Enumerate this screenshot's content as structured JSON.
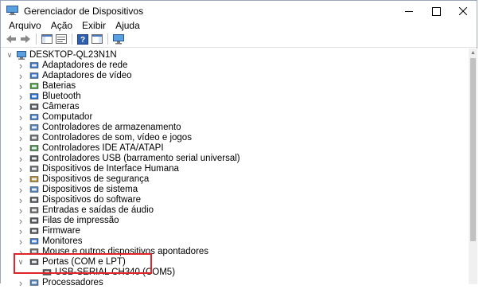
{
  "window": {
    "title": "Gerenciador de Dispositivos"
  },
  "menu": [
    "Arquivo",
    "Ação",
    "Exibir",
    "Ajuda"
  ],
  "tree": {
    "root": "DESKTOP-QL23N1N",
    "categories": [
      {
        "label": "Adaptadores de rede",
        "icon": "network-icon",
        "color": "#3b78c4"
      },
      {
        "label": "Adaptadores de vídeo",
        "icon": "display-adapter-icon",
        "color": "#3b78c4"
      },
      {
        "label": "Baterias",
        "icon": "battery-icon",
        "color": "#4a9a3a"
      },
      {
        "label": "Bluetooth",
        "icon": "bluetooth-icon",
        "color": "#1f6fd1"
      },
      {
        "label": "Câmeras",
        "icon": "camera-icon",
        "color": "#555555"
      },
      {
        "label": "Computador",
        "icon": "computer-icon",
        "color": "#3b78c4"
      },
      {
        "label": "Controladores de armazenamento",
        "icon": "storage-icon",
        "color": "#4e7fb6"
      },
      {
        "label": "Controladores de som, vídeo e jogos",
        "icon": "sound-icon",
        "color": "#6b6b6b"
      },
      {
        "label": "Controladores IDE ATA/ATAPI",
        "icon": "ide-icon",
        "color": "#4a8a4a"
      },
      {
        "label": "Controladores USB (barramento serial universal)",
        "icon": "usb-icon",
        "color": "#555555"
      },
      {
        "label": "Dispositivos de Interface Humana",
        "icon": "hid-icon",
        "color": "#6b6b6b"
      },
      {
        "label": "Dispositivos de segurança",
        "icon": "security-icon",
        "color": "#b08a2a"
      },
      {
        "label": "Dispositivos de sistema",
        "icon": "system-icon",
        "color": "#4e7fb6"
      },
      {
        "label": "Dispositivos do software",
        "icon": "software-device-icon",
        "color": "#555555"
      },
      {
        "label": "Entradas e saídas de áudio",
        "icon": "audio-icon",
        "color": "#6b6b6b"
      },
      {
        "label": "Filas de impressão",
        "icon": "printer-icon",
        "color": "#555555"
      },
      {
        "label": "Firmware",
        "icon": "firmware-icon",
        "color": "#555555"
      },
      {
        "label": "Monitores",
        "icon": "monitor-icon",
        "color": "#3b78c4"
      },
      {
        "label": "Mouse e outros dispositivos apontadores",
        "icon": "mouse-icon",
        "color": "#6b6b6b"
      },
      {
        "label": "Portas (COM e LPT)",
        "icon": "port-icon",
        "color": "#555555",
        "expanded": true
      },
      {
        "label": "USB-SERIAL CH340 (COM5)",
        "icon": "port-icon",
        "color": "#555555",
        "child": true
      },
      {
        "label": "Processadores",
        "icon": "processor-icon",
        "color": "#4e7fb6"
      }
    ]
  },
  "colors": {
    "highlight": "#e0242a"
  }
}
